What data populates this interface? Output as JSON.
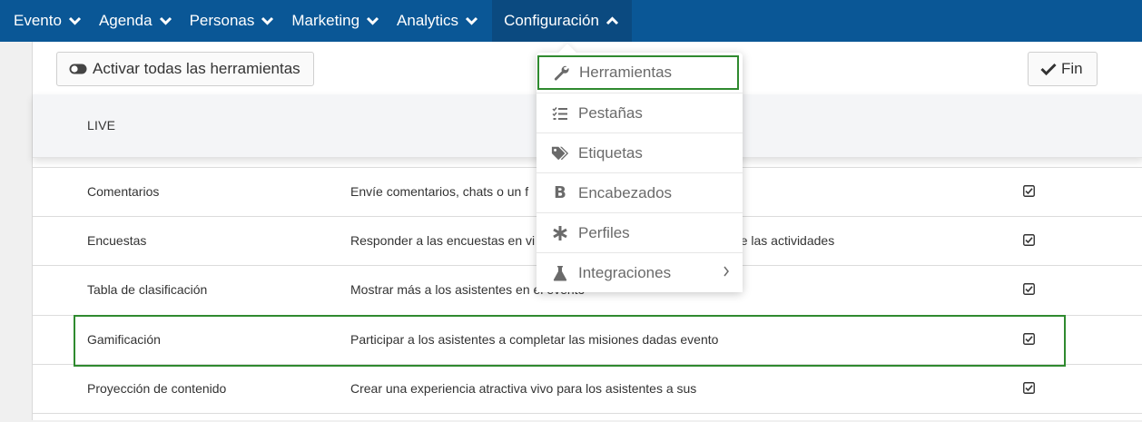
{
  "nav": {
    "items": [
      {
        "label": "Evento",
        "chevron": "down"
      },
      {
        "label": "Agenda",
        "chevron": "down"
      },
      {
        "label": "Personas",
        "chevron": "down"
      },
      {
        "label": "Marketing",
        "chevron": "down"
      },
      {
        "label": "Analytics",
        "chevron": "down"
      },
      {
        "label": "Configuración",
        "chevron": "up"
      }
    ]
  },
  "toolbar": {
    "activate_label": "Activar todas las herramientas",
    "done_label": "Fin"
  },
  "section": {
    "header": "LIVE"
  },
  "rows": [
    {
      "name": "Comentarios",
      "desc": "Envíe comentarios, chats o un f",
      "checked": true
    },
    {
      "name": "Encuestas",
      "desc": "Responder a las encuestas en vi",
      "desc_tail": "durante las actividades",
      "checked": true
    },
    {
      "name": "Tabla de clasificación",
      "desc": "Mostrar más a los asistentes en el evento",
      "checked": true
    },
    {
      "name": "Gamificación",
      "desc": "Participar a los asistentes a completar las misiones dadas evento",
      "checked": true
    },
    {
      "name": "Proyección de contenido",
      "desc": "Crear una experiencia atractiva vivo para los asistentes a sus",
      "checked": true
    }
  ],
  "dropdown": {
    "items": [
      {
        "label": "Herramientas",
        "icon": "wrench-icon"
      },
      {
        "label": "Pestañas",
        "icon": "list-checks-icon"
      },
      {
        "label": "Etiquetas",
        "icon": "tags-icon"
      },
      {
        "label": "Encabezados",
        "icon": "bold-icon"
      },
      {
        "label": "Perfiles",
        "icon": "asterisk-icon"
      },
      {
        "label": "Integraciones",
        "icon": "flask-icon"
      }
    ]
  },
  "colors": {
    "nav_bg": "#0a5796",
    "highlight": "#2f8a2f",
    "menu_text": "#6a6a6a"
  }
}
